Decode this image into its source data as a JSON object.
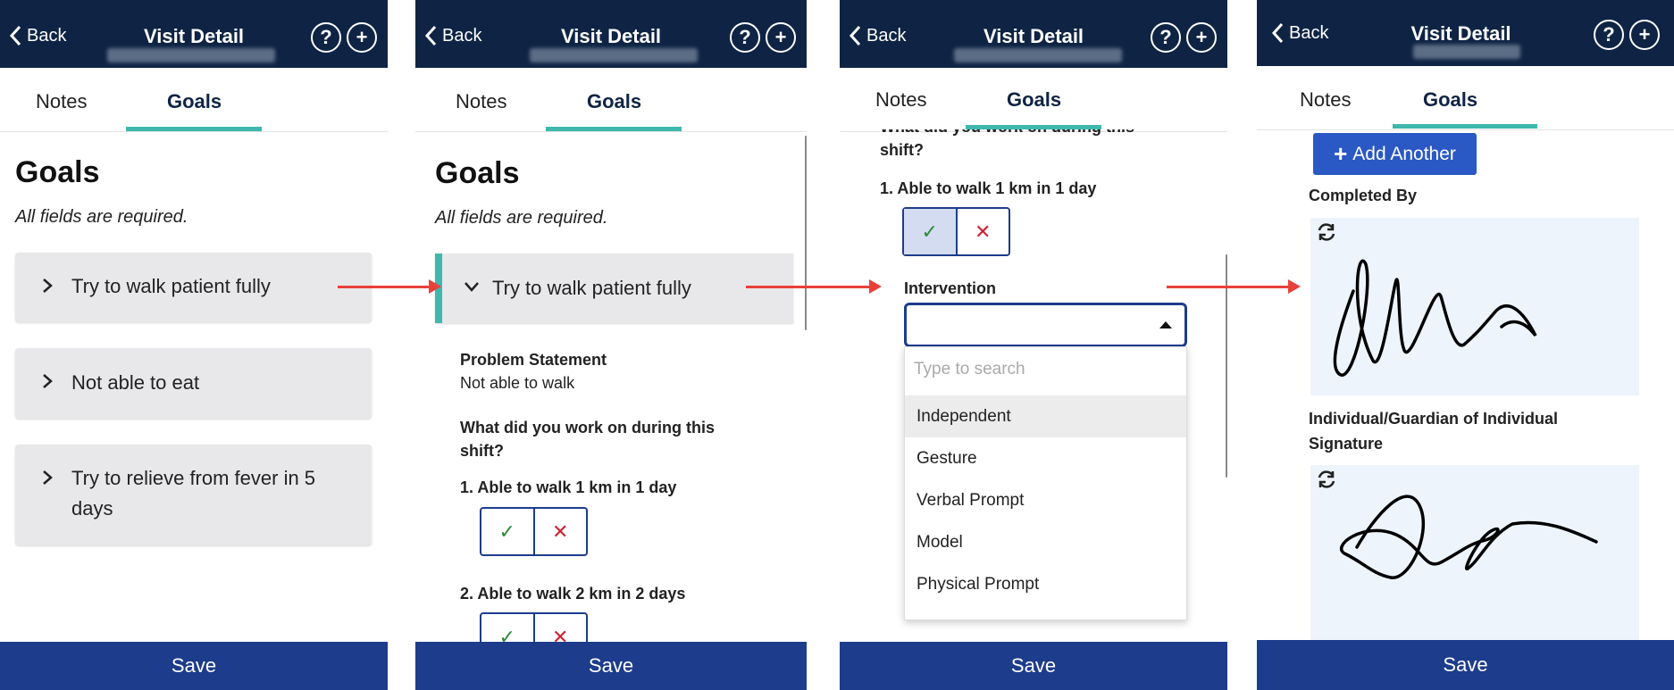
{
  "header": {
    "back_label": "Back",
    "title": "Visit Detail",
    "help_icon": "help-circle-icon",
    "add_icon": "plus-circle-icon"
  },
  "tabs": {
    "notes": "Notes",
    "goals": "Goals"
  },
  "save_label": "Save",
  "colors": {
    "header_bg": "#0f2444",
    "tab_accent": "#3eb8ac",
    "save_bg": "#1d3c8c",
    "add_btn": "#2a58c4",
    "arrow": "#e8413a",
    "check": "#2c8a3a",
    "cross": "#cc2233"
  },
  "screen1": {
    "heading": "Goals",
    "required_note": "All fields are required.",
    "goals": [
      "Try to walk patient fully",
      "Not able to eat",
      "Try to relieve from fever in 5 days"
    ]
  },
  "screen2": {
    "heading": "Goals",
    "required_note": "All fields are required.",
    "expanded_goal": "Try to walk patient fully",
    "problem_label": "Problem Statement",
    "problem_value": "Not able to walk",
    "question": "What did you work on during this shift?",
    "objectives": [
      "1. Able to walk 1 km in 1 day",
      "2. Able to walk 2 km in 2 days"
    ]
  },
  "screen3": {
    "question_partial": "What did you work on during this shift?",
    "objective": "1. Able to walk 1 km in 1 day",
    "intervention_label": "Intervention",
    "search_placeholder": "Type to search",
    "options": [
      "Independent",
      "Gesture",
      "Verbal Prompt",
      "Model",
      "Physical Prompt"
    ]
  },
  "screen4": {
    "add_another": "Add Another",
    "completed_by": "Completed By",
    "guardian_label": "Individual/Guardian of Individual Signature"
  }
}
